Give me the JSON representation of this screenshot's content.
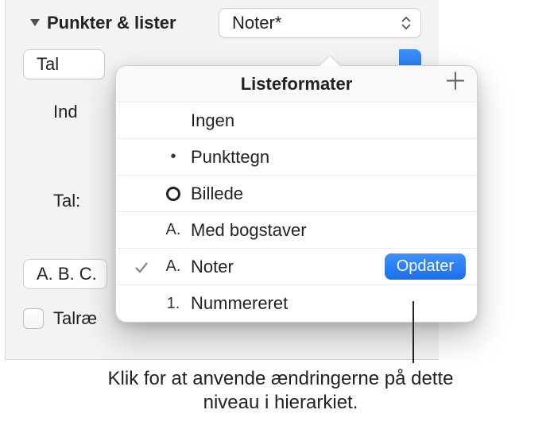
{
  "section": {
    "title": "Punkter & lister",
    "style_selected": "Noter*",
    "type_selected": "Tal",
    "indrykning_label": "Ind",
    "tal_label": "Tal:",
    "format_selected": "A. B. C.",
    "talræk_checkbox_label": "Talræ"
  },
  "popover": {
    "title": "Listeformater",
    "items": [
      {
        "bullet": "",
        "label": "Ingen",
        "selected": false
      },
      {
        "bullet": "•",
        "label": "Punkttegn",
        "selected": false
      },
      {
        "bullet": "circle",
        "label": "Billede",
        "selected": false
      },
      {
        "bullet": "A.",
        "label": "Med bogstaver",
        "selected": false
      },
      {
        "bullet": "A.",
        "label": "Noter",
        "selected": true
      },
      {
        "bullet": "1.",
        "label": "Nummereret",
        "selected": false
      }
    ],
    "update_button": "Opdater"
  },
  "callout": {
    "text": "Klik for at anvende ændringerne på dette niveau i hierarkiet."
  }
}
